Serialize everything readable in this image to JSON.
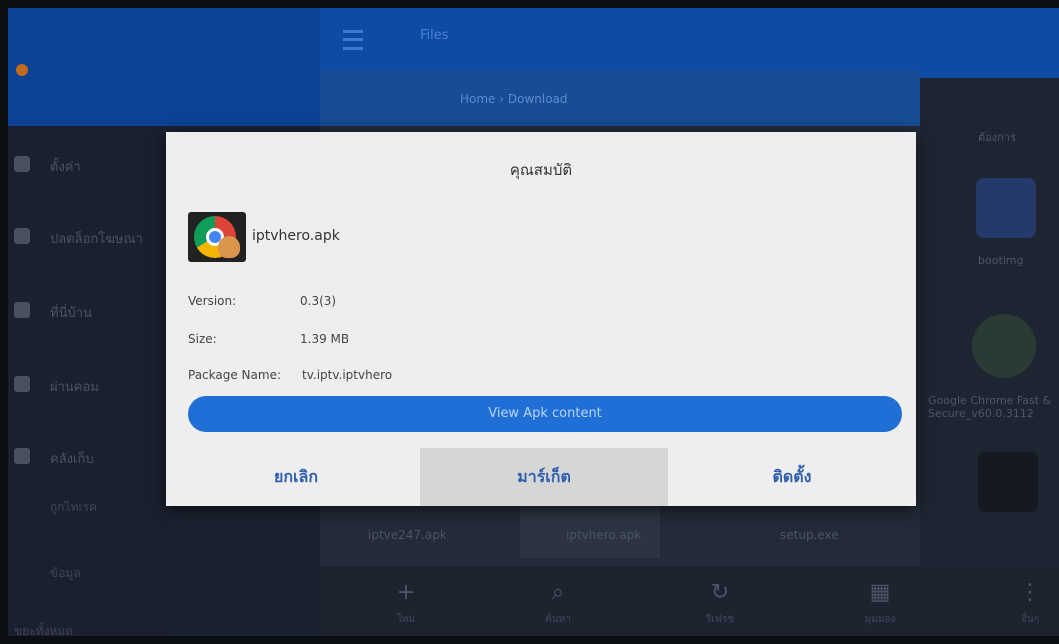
{
  "background_app": {
    "top_title": "Files",
    "breadcrumbs": "Home › Download",
    "sidebar_items": [
      {
        "label": "ตั้งค่า",
        "icon": "gear-icon"
      },
      {
        "label": "ปลดล็อกโฆษณา",
        "icon": "lock-icon"
      },
      {
        "label": "ที่นี่บ้าน",
        "icon": "home-icon"
      },
      {
        "label": "ผ่านคอม",
        "icon": "pc-icon"
      },
      {
        "label": "คลังเก็บ",
        "icon": "folder-icon"
      }
    ],
    "sidebar_lower": [
      "ถูกไทเรค",
      "ข้อมูล",
      "ขยะทั้งหมด"
    ],
    "files": [
      "iptve247.apk",
      "iptvhero.apk",
      "setup.exe"
    ],
    "right_column": {
      "header": "ต้องการ",
      "items": [
        "bootimg",
        "Google Chrome Fast & Secure_v60.0.3112"
      ]
    },
    "bottom_bar": [
      {
        "glyph": "+",
        "label": "ใหม่",
        "icon": "add-icon"
      },
      {
        "glyph": "⌕",
        "label": "ค้นหา",
        "icon": "search-icon"
      },
      {
        "glyph": "↻",
        "label": "รีเฟรช",
        "icon": "refresh-icon"
      },
      {
        "glyph": "▦",
        "label": "มุมมอง",
        "icon": "view-icon"
      },
      {
        "glyph": "⋮",
        "label": "อื่นๆ",
        "icon": "more-icon"
      }
    ]
  },
  "dialog": {
    "title": "คุณสมบัติ",
    "app_name": "iptvhero.apk",
    "version_label": "Version:",
    "version_value": "0.3(3)",
    "size_label": "Size:",
    "size_value": "1.39 MB",
    "package_label": "Package Name:",
    "package_value": "tv.iptv.iptvhero",
    "view_button": "View Apk content",
    "actions": {
      "cancel": "ยกเลิก",
      "market": "มาร์เก็ต",
      "install": "ติดตั้ง"
    }
  },
  "colors": {
    "accent_blue": "#1f6fd6",
    "action_text": "#2f5fae",
    "dialog_bg": "#eeeeee"
  }
}
